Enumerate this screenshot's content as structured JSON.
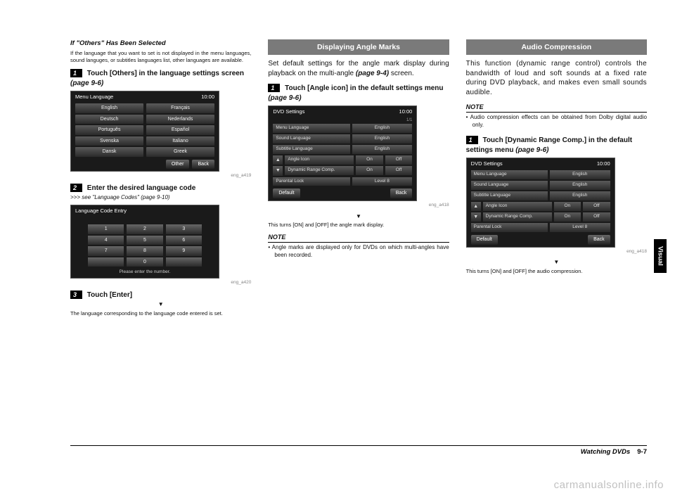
{
  "col1": {
    "sub_head": "If \"Others\" Has Been Selected",
    "intro": "If the language that you want to set is not displayed in the menu languages, sound languges, or subtitles languages list, other languages are available.",
    "step1_num": "1",
    "step1_text": "Touch [Others] in the language settings screen ",
    "step1_ref": "(page 9-6)",
    "shot1": {
      "title": "Menu Language",
      "time": "10:00",
      "rows": [
        [
          "English",
          "Français"
        ],
        [
          "Deutsch",
          "Nederlands"
        ],
        [
          "Português",
          "Español"
        ],
        [
          "Svenska",
          "Italiano"
        ],
        [
          "Dansk",
          "Greek"
        ]
      ],
      "other": "Other",
      "back": "Back",
      "caption": "eng_a419"
    },
    "step2_num": "2",
    "step2_text": "Enter the desired language code",
    "step2_ref": ">>> see \"Language Codes\" (page 9-10)",
    "shot2": {
      "title": "Language Code Entry",
      "keys": [
        [
          "1",
          "2",
          "3"
        ],
        [
          "4",
          "5",
          "6"
        ],
        [
          "7",
          "8",
          "9"
        ],
        [
          "",
          "0",
          ""
        ]
      ],
      "prompt": "Please enter the number.",
      "caption": "eng_a420"
    },
    "step3_num": "3",
    "step3_text": "Touch [Enter]",
    "arrow": "▼",
    "result": "The language corresponding to the language code entered is set."
  },
  "col2": {
    "bar": "Displaying Angle Marks",
    "intro1": "Set default settings for the angle mark display during playback on the multi-angle ",
    "intro_ref": "(page 9-4)",
    "intro2": " screen.",
    "step1_num": "1",
    "step1_text": "Touch [Angle icon] in the default settings menu ",
    "step1_ref": "(page 9-6)",
    "shot": {
      "title": "DVD Settings",
      "time": "10:00",
      "page": "1/1",
      "rows": [
        {
          "label": "Menu Language",
          "val": "English"
        },
        {
          "label": "Sound Language",
          "val": "English"
        },
        {
          "label": "Subtitle Language",
          "val": "English"
        },
        {
          "label": "Angle Icon",
          "on": "On",
          "off": "Off"
        },
        {
          "label": "Dynamic Range Comp.",
          "on": "On",
          "off": "Off"
        },
        {
          "label": "Parental Lock",
          "val": "Level 8"
        }
      ],
      "default": "Default",
      "back": "Back",
      "caption": "eng_a418"
    },
    "arrow": "▼",
    "result": "This turns [ON] and [OFF] the angle mark display.",
    "note_head": "NOTE",
    "note": "• Angle marks are displayed only for DVDs on which multi-angles have been recorded."
  },
  "col3": {
    "bar": "Audio Compression",
    "intro": "This function (dynamic range control) controls the bandwidth of loud and soft sounds at a fixed rate during DVD playback, and makes even small sounds audible.",
    "note_head": "NOTE",
    "note": "• Audio compression effects can be obtained from Dolby digital audio only.",
    "step1_num": "1",
    "step1_text": "Touch [Dynamic Range Comp.] in the default settings menu ",
    "step1_ref": "(page 9-6)",
    "shot": {
      "title": "DVD Settings",
      "time": "10:00",
      "rows": [
        {
          "label": "Menu Language",
          "val": "English"
        },
        {
          "label": "Sound Language",
          "val": "English"
        },
        {
          "label": "Subtitle Language",
          "val": "English"
        },
        {
          "label": "Angle Icon",
          "on": "On",
          "off": "Off"
        },
        {
          "label": "Dynamic Range Comp.",
          "on": "On",
          "off": "Off"
        },
        {
          "label": "Parental Lock",
          "val": "Level 8"
        }
      ],
      "default": "Default",
      "back": "Back",
      "caption": "eng_a418"
    },
    "arrow": "▼",
    "result": "This turns [ON] and [OFF] the audio compression."
  },
  "footer": {
    "title": "Watching DVDs",
    "page": "9-7"
  },
  "side_tab": "Visual",
  "watermark": "carmanualsonline.info"
}
